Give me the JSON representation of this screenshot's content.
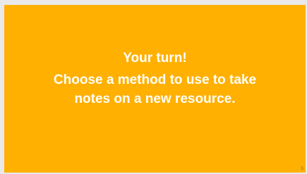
{
  "slide": {
    "title": "Your turn!",
    "body_line_1": "Choose a method to use to take",
    "body_line_2": "notes on a new resource.",
    "page_number": "5",
    "background_color": "#ffb000",
    "text_color": "#ffffff"
  }
}
